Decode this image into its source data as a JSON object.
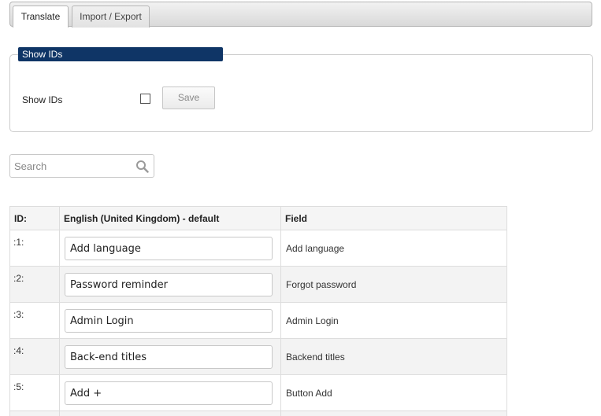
{
  "tabs": [
    {
      "label": "Translate",
      "active": true
    },
    {
      "label": "Import / Export",
      "active": false
    }
  ],
  "show_ids_panel": {
    "legend": "Show IDs",
    "label": "Show IDs",
    "checked": false,
    "save_label": "Save"
  },
  "search": {
    "placeholder": "Search",
    "value": "",
    "icon": "search-icon"
  },
  "table": {
    "columns": [
      "ID:",
      "English (United Kingdom) - default",
      "Field"
    ],
    "rows": [
      {
        "id": ":1:",
        "translation": "Add language",
        "field": "Add language"
      },
      {
        "id": ":2:",
        "translation": "Password reminder",
        "field": "Forgot password"
      },
      {
        "id": ":3:",
        "translation": "Admin Login",
        "field": "Admin Login"
      },
      {
        "id": ":4:",
        "translation": "Back-end titles",
        "field": "Backend titles"
      },
      {
        "id": ":5:",
        "translation": "Add +",
        "field": "Button Add"
      }
    ]
  },
  "colors": {
    "legend_bg": "#0f3566",
    "alt_row_bg": "#f3f3f3",
    "border": "#dddddd"
  }
}
